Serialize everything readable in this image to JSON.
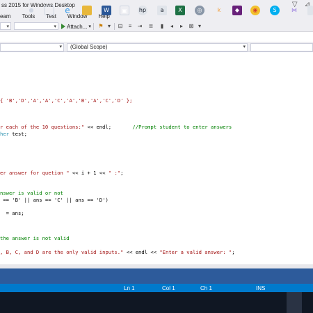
{
  "window": {
    "title": "ss 2015 for Windows Desktop"
  },
  "menu": {
    "items": [
      "eam",
      "Tools",
      "Test",
      "Window",
      "Help"
    ]
  },
  "toolbar": {
    "attach_label": "Attach..."
  },
  "nav": {
    "left_combo": "",
    "scope_combo": "(Global Scope)"
  },
  "code": {
    "line1": {
      "a": "{ 'B','D','A','A','C','A','B','A','C','D' };"
    },
    "line2": {
      "str": "r each of the 10 questions:\"",
      "code": " << endl;",
      "cmt": "       //Prompt student to enter answers"
    },
    "line3": {
      "type": "her",
      "code": " test;"
    },
    "line4": {
      "str": "er answer for quetion \"",
      "code": " << i + 1 << ",
      "str2": "\" :\"",
      "code2": ";"
    },
    "line5": {
      "cmt": "nswer is valid or not"
    },
    "line6": {
      "code": " == 'B' || ans == 'C' || ans == 'D')"
    },
    "line7": {
      "code": "  = ans;"
    },
    "line8": {
      "cmt": "the answer is not valid"
    },
    "line9": {
      "str": ", B, C, and D are the only valid inputs.\"",
      "code": " << endl << ",
      "str2": "\"Enter a valid answer: \"",
      "code2": ";"
    }
  },
  "status": {
    "ln": "Ln 1",
    "col": "Col 1",
    "ch": "Ch 1",
    "mode": "INS"
  },
  "taskbar": {
    "icons": [
      "mic-icon",
      "task-view-icon",
      "edge-icon",
      "file-explorer-icon",
      "word-icon",
      "store-icon",
      "hp-icon",
      "amazon-icon",
      "excel-icon",
      "media-icon",
      "k-app-icon",
      "visual-studio-purple-icon",
      "chrome-icon",
      "skype-icon",
      "visual-studio-icon",
      "chat-icon"
    ],
    "colors": {
      "background": "#101723",
      "status_bar": "#007acc",
      "panel_strip": "#2d5b9b"
    }
  }
}
